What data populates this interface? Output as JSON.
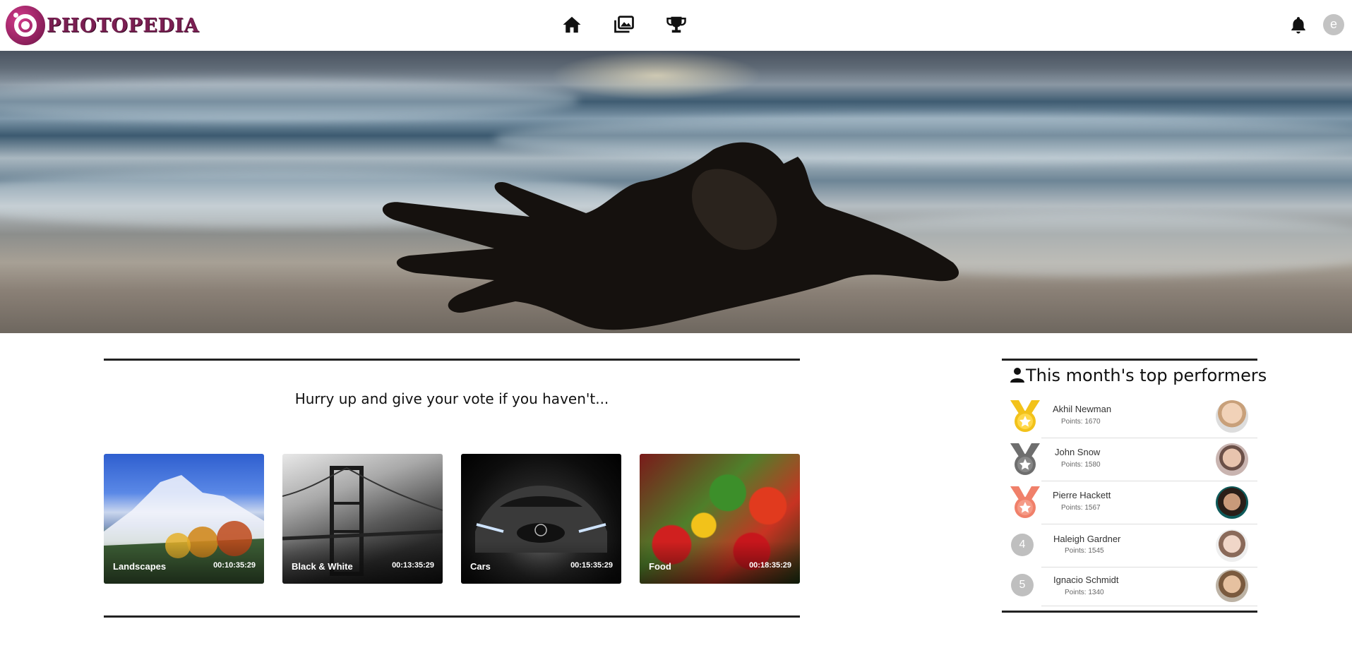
{
  "app": {
    "logo_text": "PHOTOPEDIA"
  },
  "header": {
    "nav_icons": [
      "home-icon",
      "gallery-icon",
      "trophy-icon"
    ],
    "notification_icon": "bell-icon",
    "user_initial": "e"
  },
  "vote": {
    "title": "Hurry up and give your vote if you haven't...",
    "contests": [
      {
        "name": "Landscapes",
        "time_left": "00:10:35:29"
      },
      {
        "name": "Black & White",
        "time_left": "00:13:35:29"
      },
      {
        "name": "Cars",
        "time_left": "00:15:35:29"
      },
      {
        "name": "Food",
        "time_left": "00:18:35:29"
      }
    ]
  },
  "performers": {
    "title": "This month's top performers",
    "items": [
      {
        "rank": "1",
        "name": "Akhil Newman",
        "points": "Points: 1670",
        "medal": "gold",
        "medal_color": "#f2c21a"
      },
      {
        "rank": "2",
        "name": "John Snow",
        "points": "Points: 1580",
        "medal": "silver",
        "medal_color": "#6e6e6e"
      },
      {
        "rank": "3",
        "name": "Pierre Hackett",
        "points": "Points: 1567",
        "medal": "bronze",
        "medal_color": "#f0806a"
      },
      {
        "rank": "4",
        "name": "Haleigh Gardner",
        "points": "Points: 1545"
      },
      {
        "rank": "5",
        "name": "Ignacio Schmidt",
        "points": "Points: 1340"
      }
    ]
  },
  "colors": {
    "brand": "#7a1f52",
    "rank_badge": "#bfbfbf"
  }
}
